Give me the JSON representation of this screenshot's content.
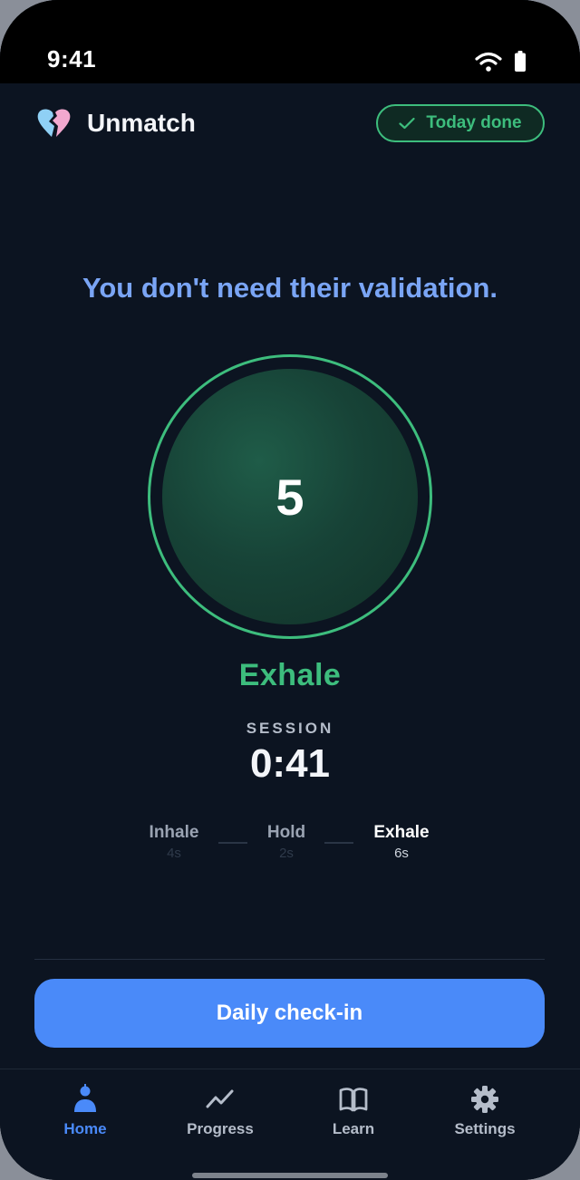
{
  "status_bar": {
    "time": "9:41"
  },
  "header": {
    "app_name": "Unmatch",
    "badge_label": "Today done"
  },
  "affirmation": "You don't need their validation.",
  "breathing": {
    "count": "5",
    "phase": "Exhale",
    "session_label": "SESSION",
    "session_time": "0:41",
    "steps": [
      {
        "name": "Inhale",
        "duration": "4s"
      },
      {
        "name": "Hold",
        "duration": "2s"
      },
      {
        "name": "Exhale",
        "duration": "6s"
      }
    ],
    "active_step": "Exhale"
  },
  "cta": {
    "label": "Daily check-in"
  },
  "tabs": [
    {
      "label": "Home",
      "icon": "person-icon",
      "active": true
    },
    {
      "label": "Progress",
      "icon": "trend-line-icon",
      "active": false
    },
    {
      "label": "Learn",
      "icon": "open-book-icon",
      "active": false
    },
    {
      "label": "Settings",
      "icon": "gear-icon",
      "active": false
    }
  ],
  "colors": {
    "background": "#0c1421",
    "accent_green": "#3dbd7d",
    "accent_blue": "#4a8af9",
    "affirmation_blue": "#7aa5f5"
  }
}
